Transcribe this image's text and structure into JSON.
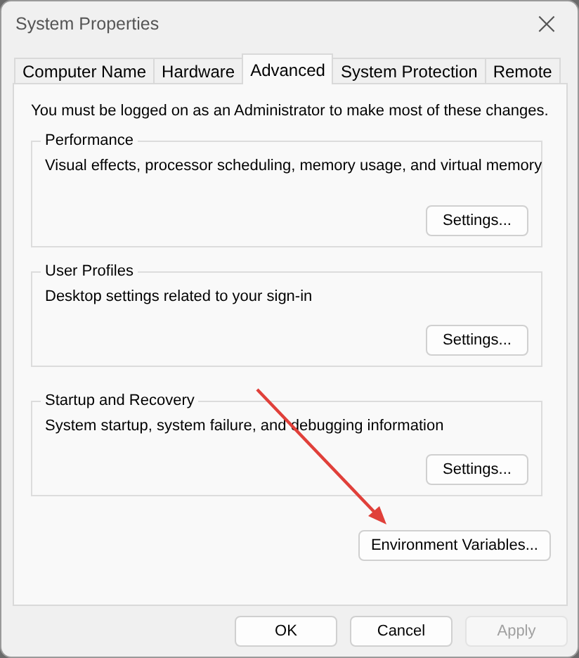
{
  "window": {
    "title": "System Properties",
    "close": "×"
  },
  "tabs": [
    {
      "label": "Computer Name",
      "selected": false
    },
    {
      "label": "Hardware",
      "selected": false
    },
    {
      "label": "Advanced",
      "selected": true
    },
    {
      "label": "System Protection",
      "selected": false
    },
    {
      "label": "Remote",
      "selected": false
    }
  ],
  "notice": "You must be logged on as an Administrator to make most of these changes.",
  "groups": [
    {
      "title": "Performance",
      "description": "Visual effects, processor scheduling, memory usage, and virtual memory",
      "button": "Settings..."
    },
    {
      "title": "User Profiles",
      "description": "Desktop settings related to your sign-in",
      "button": "Settings..."
    },
    {
      "title": "Startup and Recovery",
      "description": "System startup, system failure, and debugging information",
      "button": "Settings..."
    }
  ],
  "environment_button": "Environment Variables...",
  "buttons": [
    {
      "label": "OK",
      "disabled": false
    },
    {
      "label": "Cancel",
      "disabled": false
    },
    {
      "label": "Apply",
      "disabled": true
    }
  ]
}
